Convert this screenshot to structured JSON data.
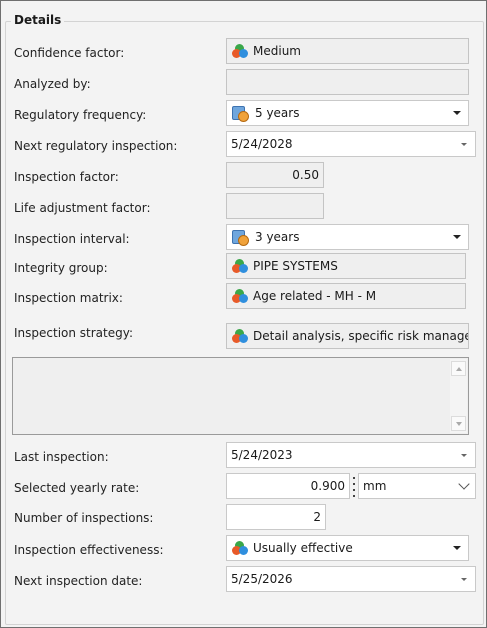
{
  "group_title": "Details",
  "fields": {
    "confidence_factor": {
      "label": "Confidence factor:",
      "value": "Medium"
    },
    "analyzed_by": {
      "label": "Analyzed by:",
      "value": ""
    },
    "regulatory_frequency": {
      "label": "Regulatory frequency:",
      "value": "5 years"
    },
    "next_regulatory_inspection": {
      "label": "Next regulatory inspection:",
      "value": "5/24/2028"
    },
    "inspection_factor": {
      "label": "Inspection factor:",
      "value": "0.50"
    },
    "life_adjustment_factor": {
      "label": "Life adjustment factor:",
      "value": ""
    },
    "inspection_interval": {
      "label": "Inspection interval:",
      "value": "3 years"
    },
    "integrity_group": {
      "label": "Integrity group:",
      "value": "PIPE SYSTEMS"
    },
    "inspection_matrix": {
      "label": "Inspection matrix:",
      "value": "Age related - MH - M"
    },
    "inspection_strategy": {
      "label": "Inspection strategy:",
      "value": "Detail analysis, specific risk manager"
    },
    "last_inspection": {
      "label": "Last inspection:",
      "value": "5/24/2023"
    },
    "selected_yearly_rate": {
      "label": "Selected yearly rate:",
      "value": "0.900",
      "unit": "mm"
    },
    "number_of_inspections": {
      "label": "Number of inspections:",
      "value": "2"
    },
    "inspection_effectiveness": {
      "label": "Inspection effectiveness:",
      "value": "Usually effective"
    },
    "next_inspection_date": {
      "label": "Next inspection date:",
      "value": "5/25/2026"
    }
  },
  "memo": {
    "value": ""
  },
  "icons": {
    "risk": "colored-circles-icon",
    "calendar": "calendar-clock-icon"
  },
  "colors": {
    "panel_bg": "#f3f3f3",
    "readonly_bg": "#efefef",
    "border": "#c9c9c9"
  }
}
